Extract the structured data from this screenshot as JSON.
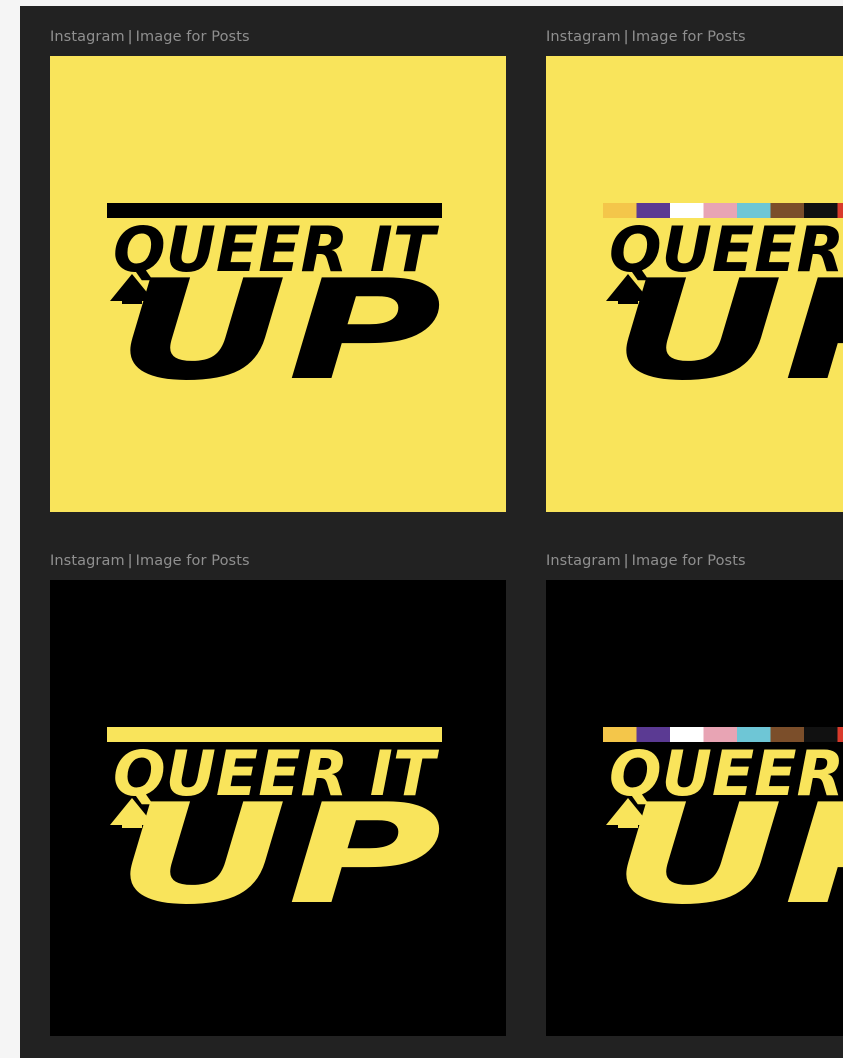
{
  "colors": {
    "canvas_bg": "#222222",
    "label_text": "#8f8f8f",
    "brand_yellow": "#F9E45B",
    "brand_black": "#000000"
  },
  "frames": [
    {
      "label_app": "Instagram",
      "label_separator": "|",
      "label_kind": "Image for Posts",
      "background": "#F9E45B",
      "ink": "#000000",
      "variant": "plain-bar",
      "logo_line1": "QUEER IT",
      "logo_line2": "UP"
    },
    {
      "label_app": "Instagram",
      "label_separator": "|",
      "label_kind": "Image for Posts",
      "background": "#F9E45B",
      "ink": "#000000",
      "variant": "rainbow-bar",
      "logo_line1": "QUEER IT",
      "logo_line2": "UP"
    },
    {
      "label_app": "Instagram",
      "label_separator": "|",
      "label_kind": "Image for Posts",
      "background": "#000000",
      "ink": "#F9E45B",
      "variant": "plain-bar",
      "logo_line1": "QUEER IT",
      "logo_line2": "UP"
    },
    {
      "label_app": "Instagram",
      "label_separator": "|",
      "label_kind": "Image for Posts",
      "background": "#000000",
      "ink": "#F9E45B",
      "variant": "rainbow-bar",
      "logo_line1": "QUEER IT",
      "logo_line2": "UP"
    }
  ],
  "pride_stripe_colors": [
    "#F4C64A",
    "#5B3A93",
    "#FFFFFF",
    "#E8A4B4",
    "#6EC6D6",
    "#7B4E2A",
    "#111111",
    "#D93A2B",
    "#E8893A",
    "#F4C64A"
  ]
}
